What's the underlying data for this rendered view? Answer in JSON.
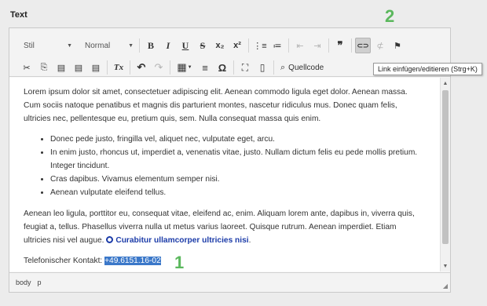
{
  "field_label": "Text",
  "callouts": {
    "step_1": "1",
    "step_2": "2",
    "color": "#5bb85d"
  },
  "toolbar": {
    "row1": {
      "style_combo": "Stil",
      "format_combo": "Normal",
      "bold": "B",
      "italic": "I",
      "underline": "U",
      "strike": "S",
      "subscript": "x₂",
      "superscript": "x²",
      "numbered_list": "⋮≡",
      "bulleted_list": "≔",
      "outdent": "⇤",
      "indent": "⇥",
      "blockquote": "❞",
      "link": "⊂⊃",
      "unlink": "⊄",
      "anchor": "⚑"
    },
    "row2": {
      "cut": "✂",
      "copy": "⎘",
      "paste": "▤",
      "paste_text": "▤",
      "paste_word": "▤",
      "remove_format": "Tx",
      "undo": "↶",
      "redo": "↷",
      "table": "▦",
      "horizontal_rule": "≡",
      "special_char": "Ω",
      "maximize": "⛶",
      "show_blocks": "▯",
      "source_icon": "⌕",
      "source_label": "Quellcode"
    },
    "tooltip": "Link einfügen/editieren (Strg+K)"
  },
  "content": {
    "paragraph_1": "Lorem ipsum dolor sit amet, consectetuer adipiscing elit. Aenean commodo ligula eget dolor. Aenean massa. Cum sociis natoque penatibus et magnis dis parturient montes, nascetur ridiculus mus. Donec quam felis, ultricies nec, pellentesque eu, pretium quis, sem. Nulla consequat massa quis enim.",
    "list_items": [
      "Donec pede justo, fringilla vel, aliquet nec, vulputate eget, arcu.",
      "In enim justo, rhoncus ut, imperdiet a, venenatis vitae, justo. Nullam dictum felis eu pede mollis pretium. Integer tincidunt.",
      "Cras dapibus. Vivamus elementum semper nisi.",
      "Aenean vulputate eleifend tellus."
    ],
    "paragraph_2": "Aenean leo ligula, porttitor eu, consequat vitae, eleifend ac, enim. Aliquam lorem ante, dapibus in, viverra quis, feugiat a, tellus. Phasellus viverra nulla ut metus varius laoreet. Quisque rutrum. Aenean imperdiet. Etiam ultricies nisi vel augue.",
    "inline_link": "Curabitur ullamcorper ultricies nisi",
    "link_end": ".",
    "phone_label": "Telefonischer Kontakt:",
    "phone_selected": "+49.6151.16-02"
  },
  "scrollbar": {
    "up": "▲",
    "down": "▼"
  },
  "statusbar": {
    "path": [
      "body",
      "p"
    ],
    "grip": "◢"
  },
  "colors": {
    "selection": "#3b78c9",
    "link": "#1b3ba8",
    "toolbar_bg": "#f3f3f3"
  }
}
